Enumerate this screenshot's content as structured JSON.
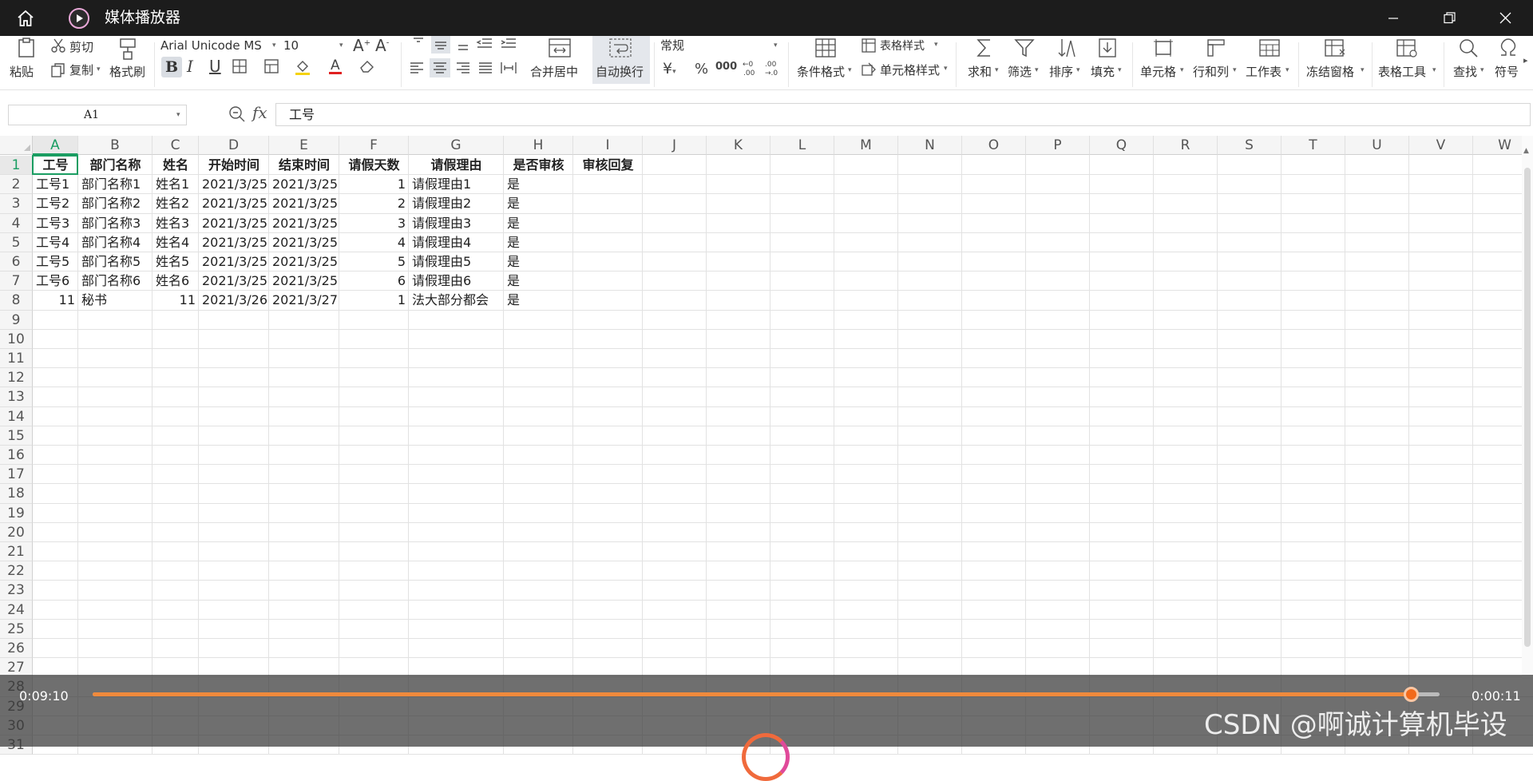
{
  "titlebar": {
    "app_title": "媒体播放器",
    "home_icon": "home-icon",
    "app_icon": "play-icon"
  },
  "ribbon": {
    "paste": "粘贴",
    "cut": "剪切",
    "copy": "复制",
    "format_painter": "格式刷",
    "font_name": "Arial Unicode MS",
    "font_size": "10",
    "merge_center": "合并居中",
    "wrap_text": "自动换行",
    "number_format": "常规",
    "currency": "¥",
    "percent": "%",
    "thousands": "000",
    "conditional_format": "条件格式",
    "table_style": "表格样式",
    "cell_style": "单元格样式",
    "sum": "求和",
    "filter": "筛选",
    "sort": "排序",
    "fill": "填充",
    "cell": "单元格",
    "row_col": "行和列",
    "worksheet": "工作表",
    "freeze": "冻结窗格",
    "table_tools": "表格工具",
    "find": "查找",
    "symbol": "符号"
  },
  "formula_bar": {
    "name_box": "A1",
    "fx_label": "fx",
    "content": "工号"
  },
  "sheet": {
    "columns": [
      "A",
      "B",
      "C",
      "D",
      "E",
      "F",
      "G",
      "H",
      "I",
      "J",
      "K",
      "L",
      "M",
      "N",
      "O",
      "P",
      "Q",
      "R",
      "S",
      "T",
      "U",
      "V",
      "W"
    ],
    "row_numbers": [
      "1",
      "2",
      "3",
      "4",
      "5",
      "6",
      "7",
      "8",
      "9",
      "10",
      "11",
      "12",
      "13",
      "14",
      "15",
      "16",
      "17",
      "18",
      "19",
      "20",
      "21",
      "22",
      "23",
      "24",
      "25",
      "26",
      "27",
      "28",
      "29",
      "30",
      "31"
    ],
    "header": [
      "工号",
      "部门名称",
      "姓名",
      "开始时间",
      "结束时间",
      "请假天数",
      "请假理由",
      "是否审核",
      "审核回复"
    ],
    "rows": [
      [
        "工号1",
        "部门名称1",
        "姓名1",
        "2021/3/25",
        "2021/3/25",
        "1",
        "请假理由1",
        "是",
        ""
      ],
      [
        "工号2",
        "部门名称2",
        "姓名2",
        "2021/3/25",
        "2021/3/25",
        "2",
        "请假理由2",
        "是",
        ""
      ],
      [
        "工号3",
        "部门名称3",
        "姓名3",
        "2021/3/25",
        "2021/3/25",
        "3",
        "请假理由3",
        "是",
        ""
      ],
      [
        "工号4",
        "部门名称4",
        "姓名4",
        "2021/3/25",
        "2021/3/25",
        "4",
        "请假理由4",
        "是",
        ""
      ],
      [
        "工号5",
        "部门名称5",
        "姓名5",
        "2021/3/25",
        "2021/3/25",
        "5",
        "请假理由5",
        "是",
        ""
      ],
      [
        "工号6",
        "部门名称6",
        "姓名6",
        "2021/3/25",
        "2021/3/25",
        "6",
        "请假理由6",
        "是",
        ""
      ],
      [
        "11",
        "秘书",
        "11",
        "2021/3/26",
        "2021/3/27",
        "1",
        "法大部分都会",
        "是",
        ""
      ]
    ]
  },
  "player": {
    "elapsed": "0:09:10",
    "remaining": "0:00:11",
    "progress": 0.9786,
    "accent": "#f26a1b"
  },
  "watermark": "CSDN @啊诚计算机毕设"
}
